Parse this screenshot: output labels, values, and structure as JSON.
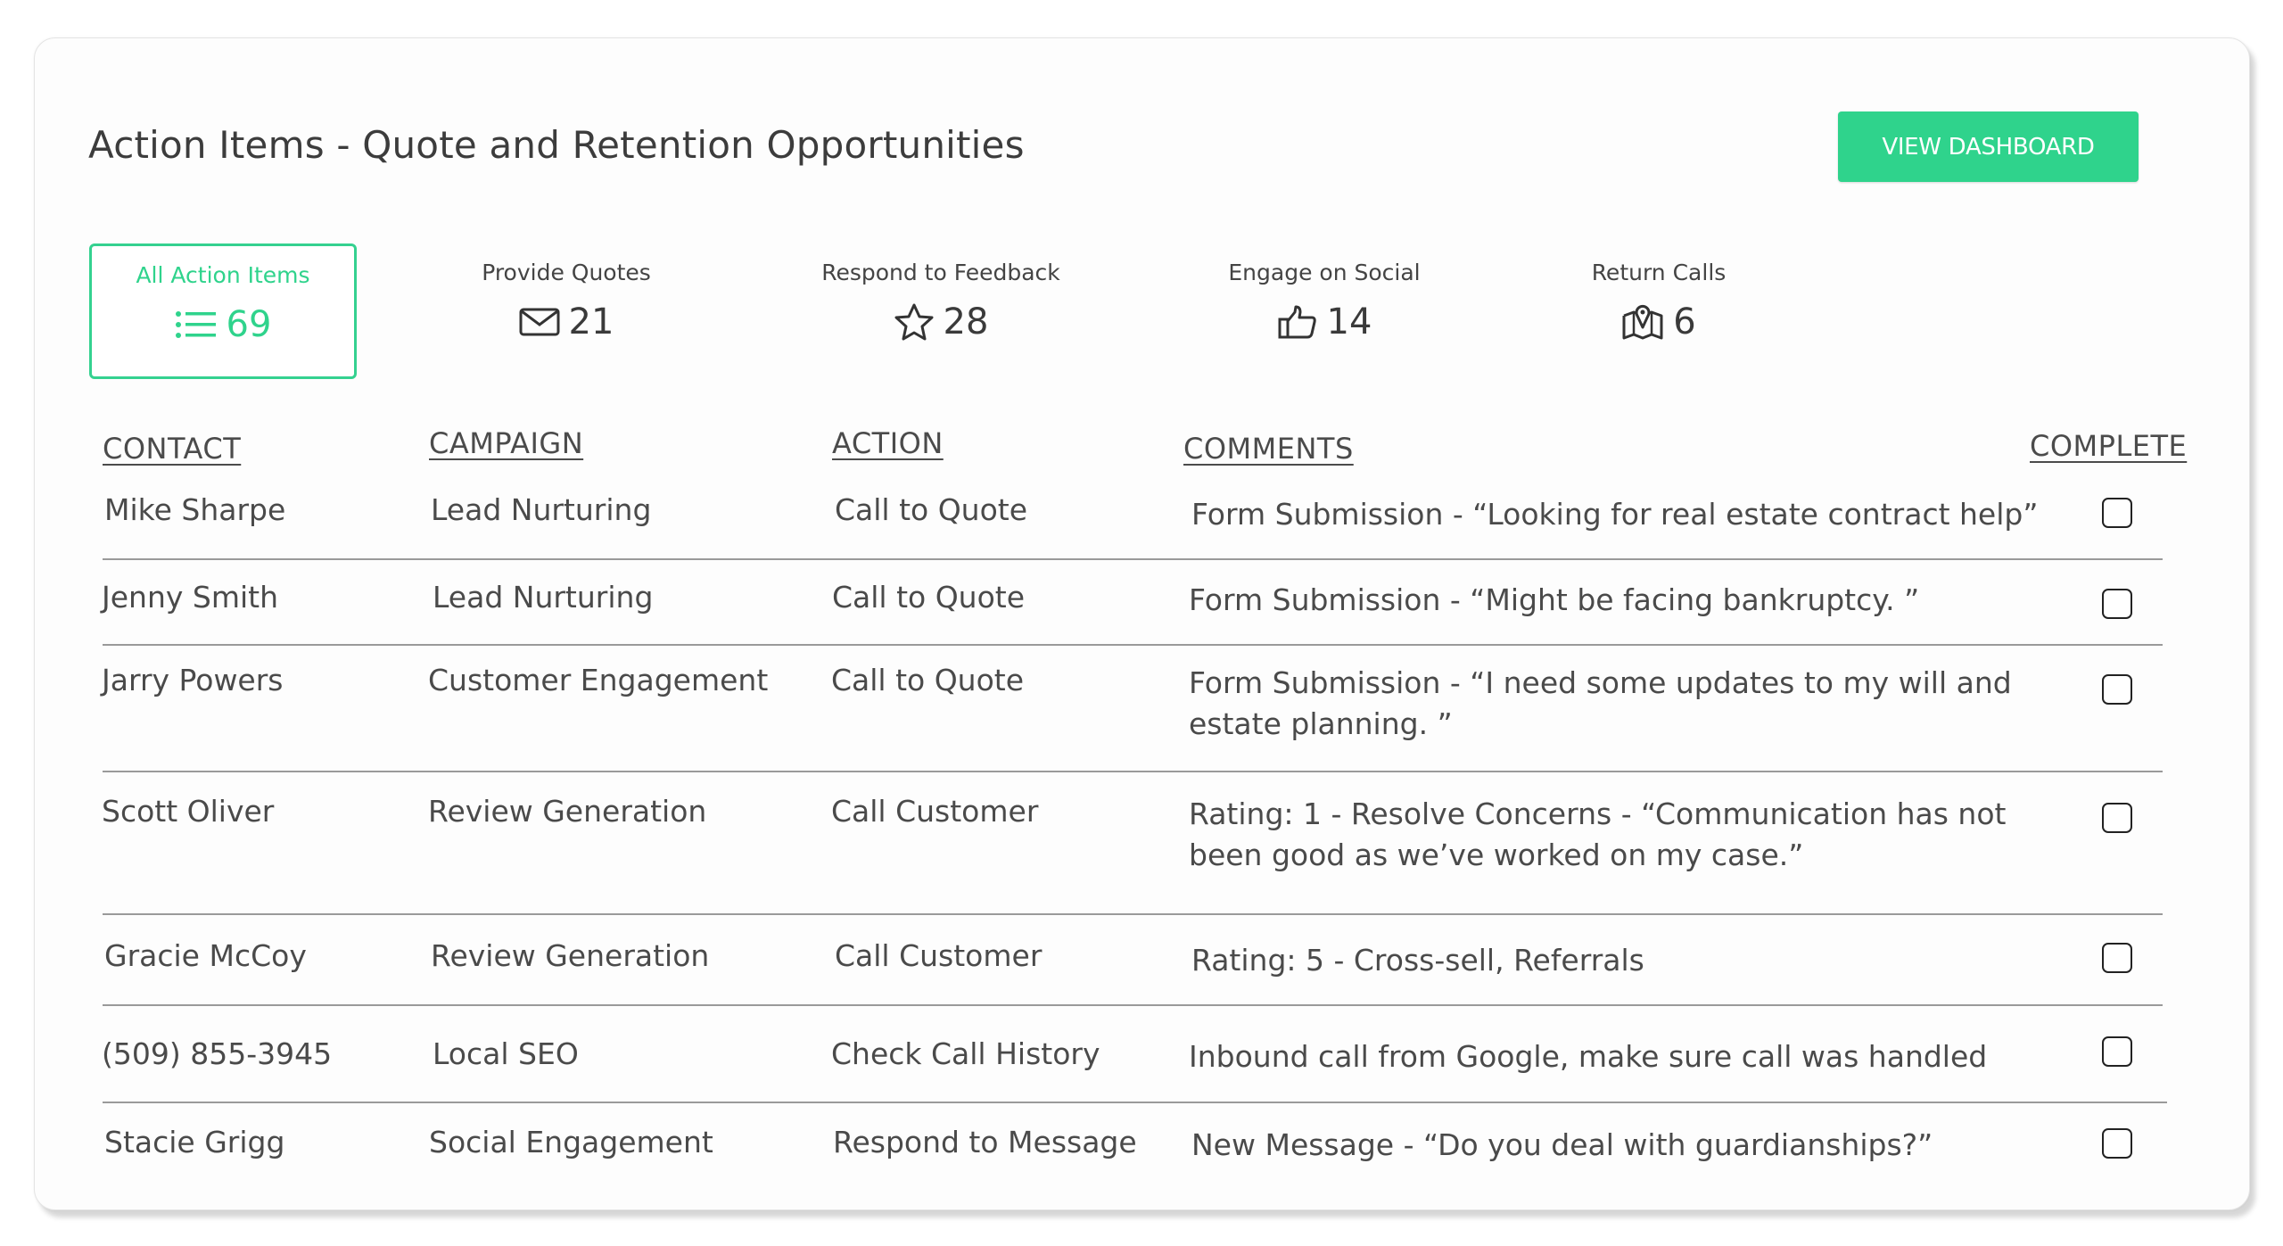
{
  "header": {
    "title": "Action Items - Quote and Retention Opportunities",
    "button_label": "VIEW DASHBOARD"
  },
  "stats": [
    {
      "label": "All Action Items",
      "count": "69",
      "icon": "list-icon"
    },
    {
      "label": "Provide Quotes",
      "count": "21",
      "icon": "envelope-icon"
    },
    {
      "label": "Respond to Feedback",
      "count": "28",
      "icon": "star-icon"
    },
    {
      "label": "Engage on Social",
      "count": "14",
      "icon": "thumbs-up-icon"
    },
    {
      "label": "Return Calls",
      "count": "6",
      "icon": "map-pin-icon"
    }
  ],
  "table": {
    "columns": [
      "CONTACT",
      "CAMPAIGN",
      "ACTION",
      "COMMENTS",
      "COMPLETE"
    ],
    "rows": [
      {
        "contact": "Mike Sharpe",
        "campaign": "Lead Nurturing",
        "action": "Call to Quote",
        "comment": "Form Submission - “Looking for real estate contract help”",
        "complete": false
      },
      {
        "contact": "Jenny Smith",
        "campaign": "Lead Nurturing",
        "action": "Call to Quote",
        "comment": "Form Submission - “Might be facing bankruptcy. ”",
        "complete": false
      },
      {
        "contact": "Jarry Powers",
        "campaign": "Customer Engagement",
        "action": "Call to Quote",
        "comment": "Form Submission - “I need some updates to my will and estate planning. ”",
        "complete": false
      },
      {
        "contact": "Scott Oliver",
        "campaign": "Review Generation",
        "action": "Call Customer",
        "comment": "Rating: 1 - Resolve Concerns - “Communication has not been good as we’ve worked on my case.”",
        "complete": false
      },
      {
        "contact": "Gracie McCoy",
        "campaign": "Review Generation",
        "action": "Call Customer",
        "comment": "Rating: 5 - Cross-sell, Referrals",
        "complete": false
      },
      {
        "contact": "(509) 855-3945",
        "campaign": "Local SEO",
        "action": "Check Call History",
        "comment": "Inbound call from Google, make sure call was handled",
        "complete": false
      },
      {
        "contact": "Stacie Grigg",
        "campaign": "Social Engagement",
        "action": "Respond to Message",
        "comment": "New Message - “Do you deal with guardianships?”",
        "complete": false
      }
    ]
  },
  "colors": {
    "accent": "#2fd38c",
    "text": "#4a4a4a",
    "separator": "#9a9a9a"
  }
}
